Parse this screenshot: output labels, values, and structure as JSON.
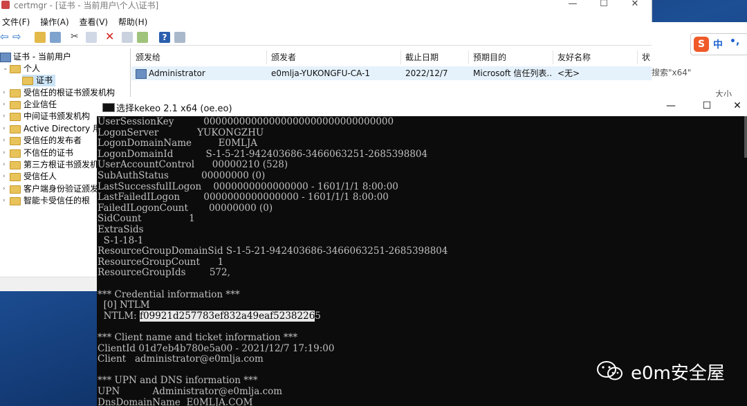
{
  "certmgr": {
    "title": "certmgr - [证书 - 当前用户\\个人\\证书]",
    "menu": [
      "文件(F)",
      "操作(A)",
      "查看(V)",
      "帮助(H)"
    ],
    "tree": [
      {
        "label": "证书 - 当前用户"
      },
      {
        "label": "个人"
      },
      {
        "label": "证书"
      },
      {
        "label": "受信任的根证书颁发机构"
      },
      {
        "label": "企业信任"
      },
      {
        "label": "中间证书颁发机构"
      },
      {
        "label": "Active Directory 用户"
      },
      {
        "label": "受信任的发布者"
      },
      {
        "label": "不信任的证书"
      },
      {
        "label": "第三方根证书颁发机"
      },
      {
        "label": "受信任人"
      },
      {
        "label": "客户端身份验证颁发"
      },
      {
        "label": "智能卡受信任的根"
      }
    ],
    "columns": [
      "颁发给",
      "颁发者",
      "截止日期",
      "预期目的",
      "友好名称",
      "状"
    ],
    "row": {
      "issued_to": "Administrator",
      "issuer": "e0mlja-YUKONGFU-CA-1",
      "expiry": "2022/12/7",
      "purpose": "Microsoft 信任列表...",
      "friendly": "<无>"
    }
  },
  "right_panel": {
    "ime_zh": "中",
    "ime_dot": "•,",
    "search_hint": "搜索\"x64\"",
    "size_label": "大小"
  },
  "console": {
    "title": "选择kekeo 2.1 x64 (oe.eo)",
    "lines": [
      "UserSessionKey          00000000000000000000000000000000",
      "LogonServer             YUKONGZHU",
      "LogonDomainName         E0MLJA",
      "LogonDomainId           S-1-5-21-942403686-3466063251-2685398804",
      "UserAccountControl      00000210 (528)",
      "SubAuthStatus           00000000 (0)",
      "LastSuccessfulILogon    0000000000000000 - 1601/1/1 8:00:00",
      "LastFailedILogon        0000000000000000 - 1601/1/1 8:00:00",
      "FailedILogonCount       00000000 (0)",
      "SidCount                1",
      "ExtraSids",
      "  S-1-18-1",
      "ResourceGroupDomainSid S-1-5-21-942403686-3466063251-2685398804",
      "ResourceGroupCount      1",
      "ResourceGroupIds        572,",
      "",
      "*** Credential information ***",
      "  [0] NTLM",
      "",
      "",
      "*** Client name and ticket information ***",
      "ClientId 01d7eb4b780e5a00 - 2021/12/7 17:19:00",
      "Client   administrator@e0mlja.com",
      "",
      "*** UPN and DNS information ***",
      "UPN           Administrator@e0mlja.com",
      "DnsDomainName  E0MLJA.COM"
    ],
    "ntlm_prefix": "  NTLM: ",
    "ntlm_highlight": "f09921d257783ef832a49eaf5238226",
    "ntlm_tail": "5"
  },
  "watermark": {
    "text": "e0m安全屋"
  }
}
